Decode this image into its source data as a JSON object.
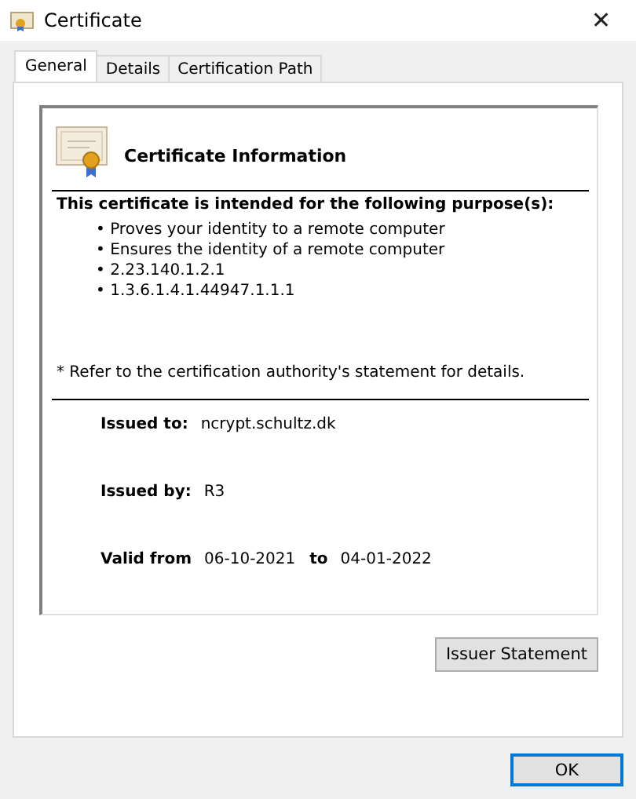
{
  "window": {
    "title": "Certificate",
    "close": "✕"
  },
  "tabs": [
    {
      "label": "General",
      "selected": true
    },
    {
      "label": "Details",
      "selected": false
    },
    {
      "label": "Certification Path",
      "selected": false
    }
  ],
  "info": {
    "heading": "Certificate Information",
    "purpose_heading": "This certificate is intended for the following purpose(s):",
    "purposes": [
      "• Proves your identity to a remote computer",
      "• Ensures the identity of a remote computer",
      "• 2.23.140.1.2.1",
      "• 1.3.6.1.4.1.44947.1.1.1"
    ],
    "note": "* Refer to the certification authority's statement for details.",
    "issued_to_label": "Issued to:",
    "issued_to": "ncrypt.schultz.dk",
    "issued_by_label": "Issued by:",
    "issued_by": "R3",
    "valid_from_label": "Valid from",
    "valid_from": "06-10-2021",
    "to_label": "to",
    "valid_to": "04-01-2022"
  },
  "buttons": {
    "issuer_statement": "Issuer Statement",
    "ok": "OK"
  }
}
